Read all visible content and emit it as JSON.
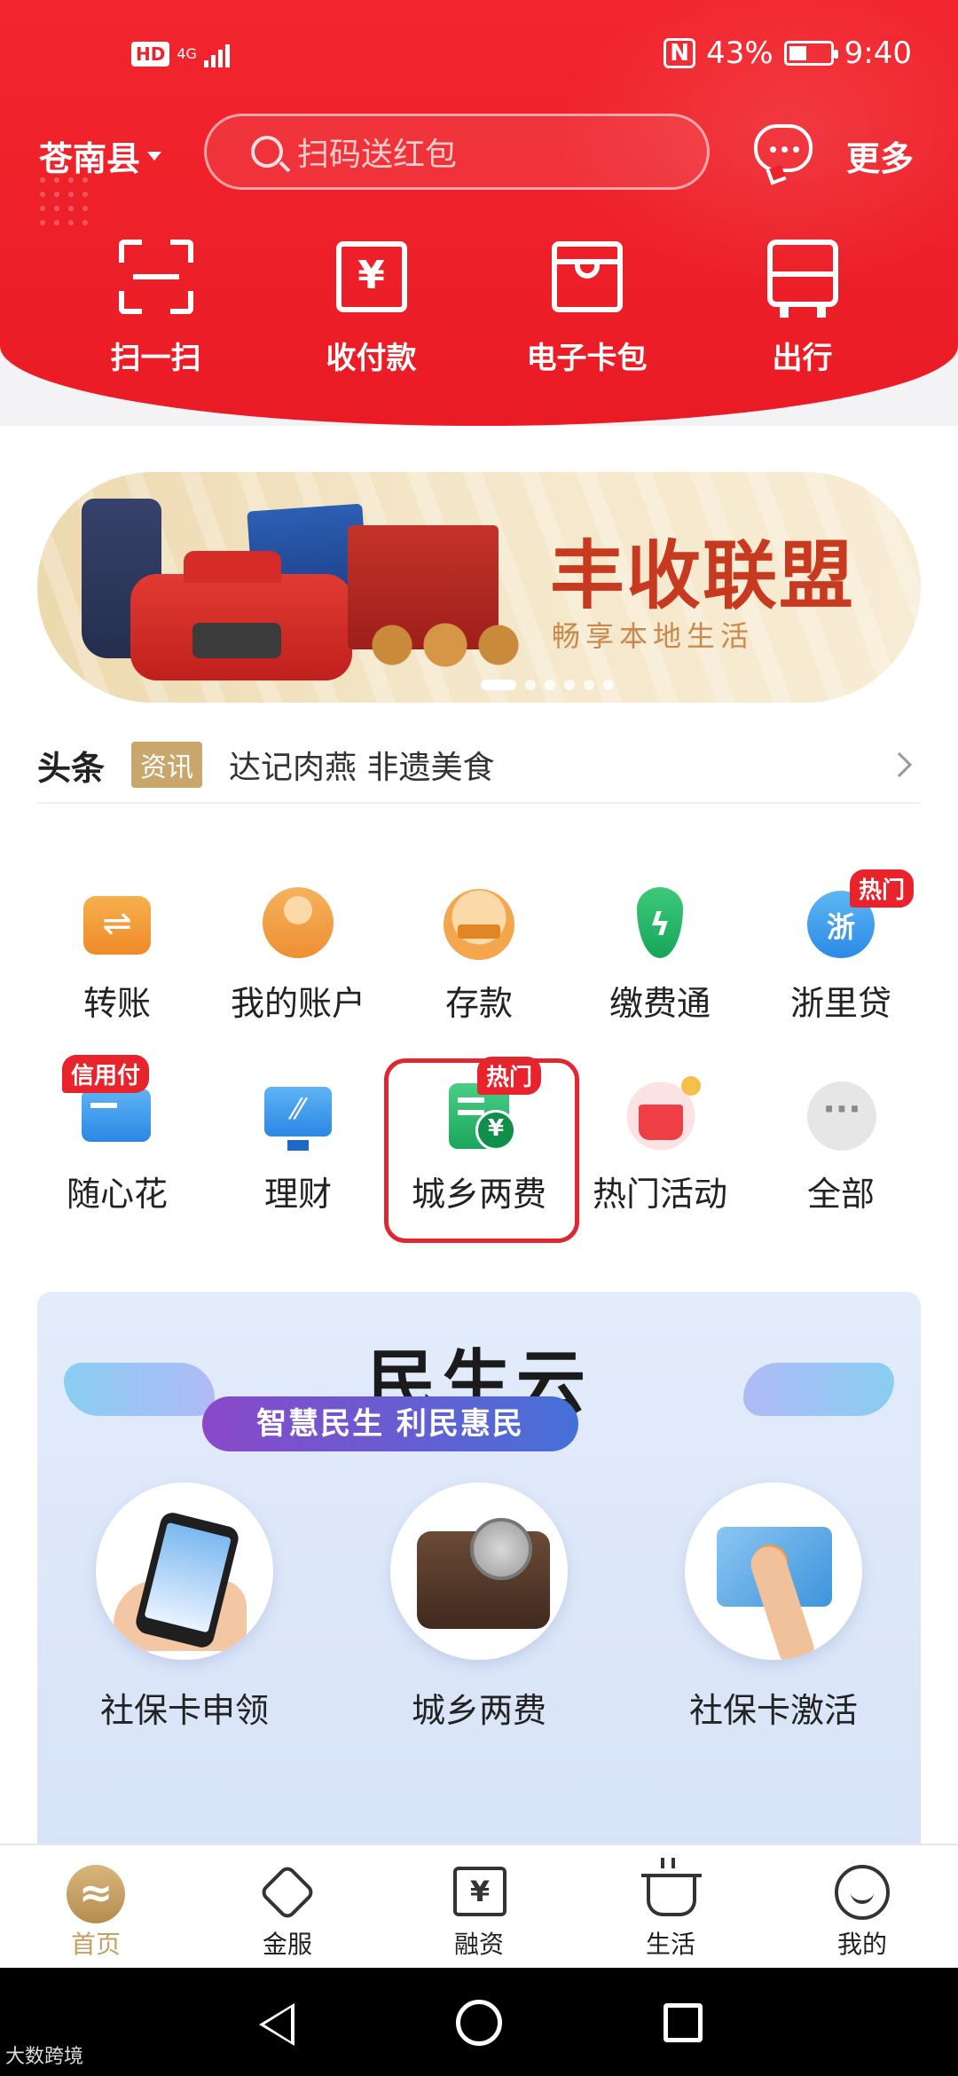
{
  "status_bar": {
    "hd": "HD",
    "network": "4G",
    "nfc": "N",
    "battery_pct": "43%",
    "battery_level": 0.43,
    "time": "9:40"
  },
  "header": {
    "region": "苍南县",
    "search_placeholder": "扫码送红包",
    "more": "更多",
    "background_color": "#ee1f27"
  },
  "quick_actions": [
    {
      "label": "扫一扫",
      "icon": "scan-icon"
    },
    {
      "label": "收付款",
      "icon": "yen-icon"
    },
    {
      "label": "电子卡包",
      "icon": "card-wallet-icon"
    },
    {
      "label": "出行",
      "icon": "bus-icon"
    }
  ],
  "banner": {
    "title": "丰收联盟",
    "subtitle": "畅享本地生活",
    "slide_count": 6,
    "active_slide": 0
  },
  "headline": {
    "title": "头条",
    "tag": "资讯",
    "text": "达记肉燕 非遗美食"
  },
  "services": {
    "row1": [
      {
        "label": "转账",
        "icon": "transfer-icon"
      },
      {
        "label": "我的账户",
        "icon": "account-icon"
      },
      {
        "label": "存款",
        "icon": "deposit-icon"
      },
      {
        "label": "缴费通",
        "icon": "payment-icon"
      },
      {
        "label": "浙里贷",
        "icon": "loan-icon",
        "badge": "热门"
      }
    ],
    "row2": [
      {
        "label": "随心花",
        "icon": "credit-card-icon",
        "badge": "信用付"
      },
      {
        "label": "理财",
        "icon": "finance-icon"
      },
      {
        "label": "城乡两费",
        "icon": "fee-bill-icon",
        "badge": "热门",
        "highlighted": true
      },
      {
        "label": "热门活动",
        "icon": "activity-icon"
      },
      {
        "label": "全部",
        "icon": "more-dots-icon",
        "glyph": "···"
      }
    ]
  },
  "minsheng": {
    "title": "民生云",
    "slogan": "智慧民生  利民惠民",
    "items": [
      {
        "label": "社保卡申领",
        "icon": "phone-hand-icon"
      },
      {
        "label": "城乡两费",
        "icon": "wallet-icon"
      },
      {
        "label": "社保卡激活",
        "icon": "social-card-icon"
      }
    ]
  },
  "tabbar": {
    "active": "首页",
    "active_color": "#c4a063",
    "tabs": [
      {
        "label": "首页",
        "icon": "home-logo-icon"
      },
      {
        "label": "金服",
        "icon": "heart-icon"
      },
      {
        "label": "融资",
        "icon": "yen-box-icon",
        "glyph": "¥"
      },
      {
        "label": "生活",
        "icon": "cup-icon"
      },
      {
        "label": "我的",
        "icon": "smile-icon"
      }
    ]
  },
  "watermark": "大数跨境"
}
